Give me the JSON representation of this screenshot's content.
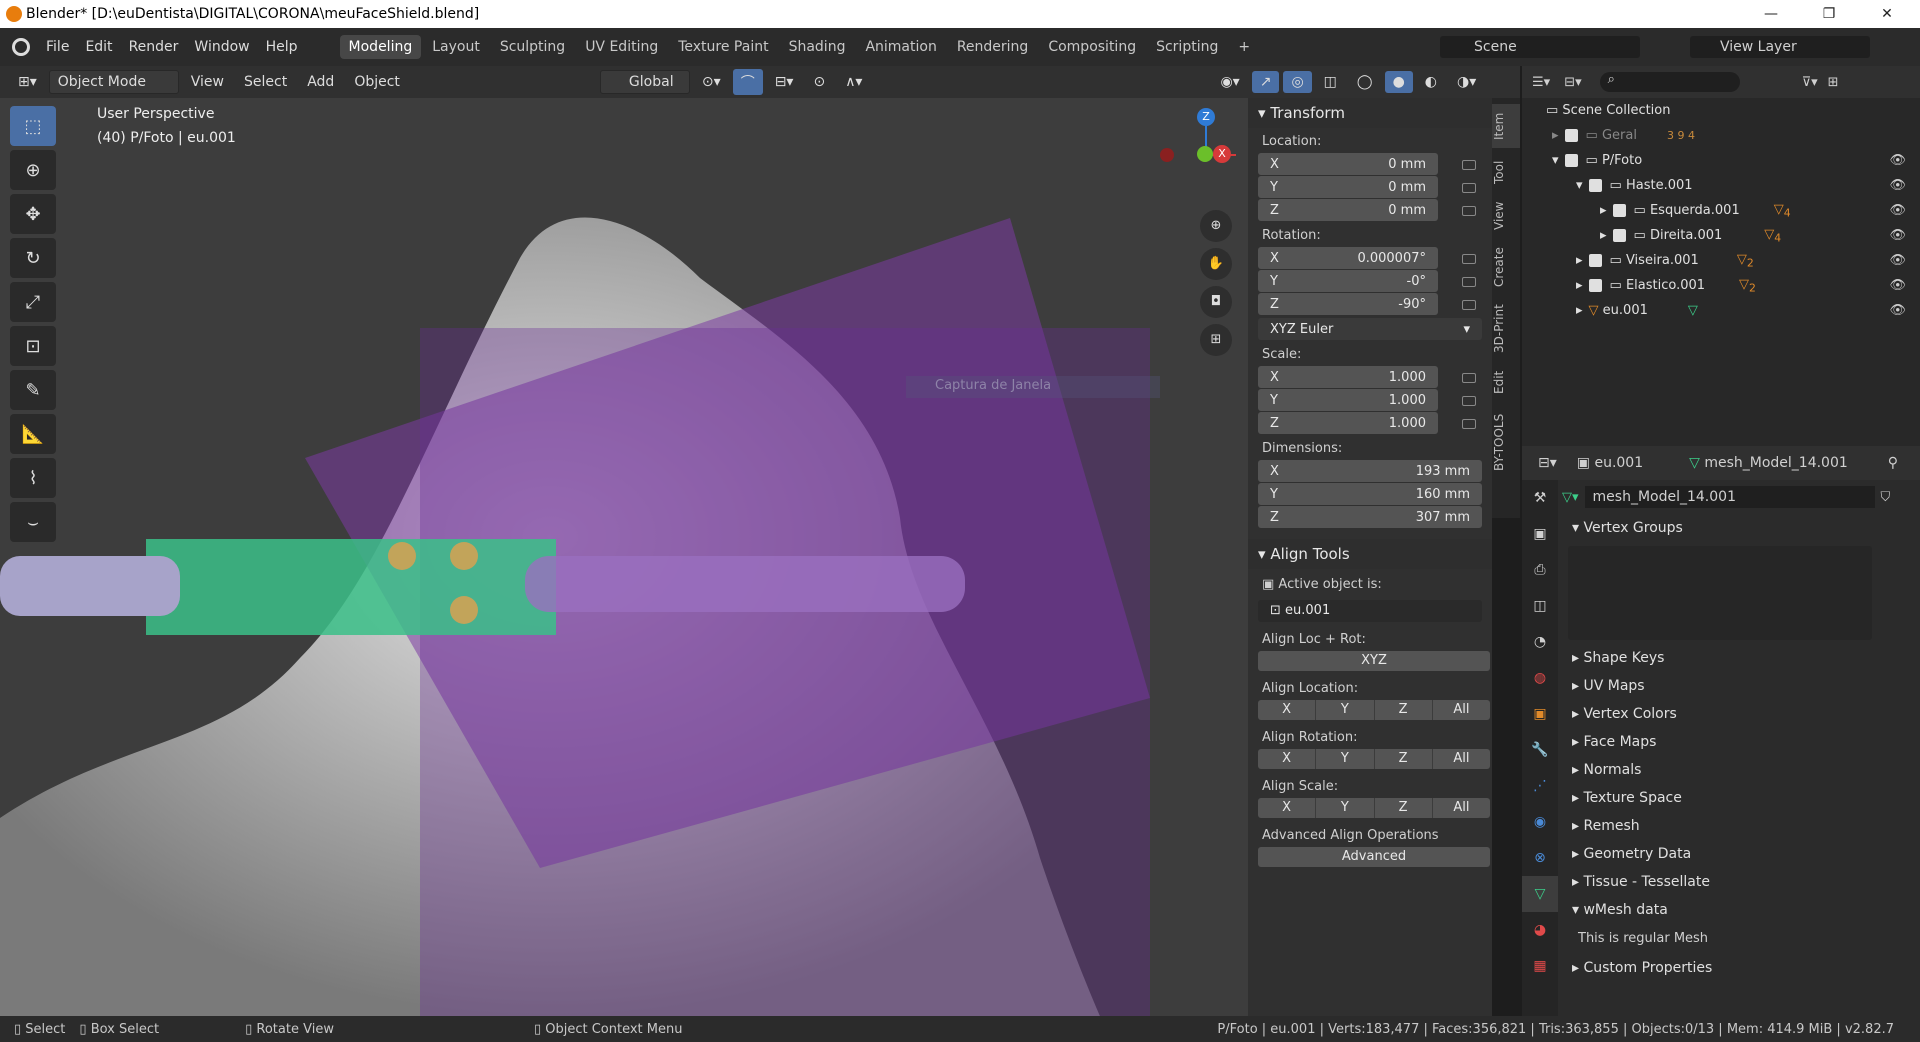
{
  "window": {
    "title": "Blender* [D:\\euDentista\\DIGITAL\\CORONA\\meuFaceShield.blend]",
    "minimize": "—",
    "maximize": "❐",
    "close": "✕"
  },
  "menu": {
    "file": "File",
    "edit": "Edit",
    "render": "Render",
    "window": "Window",
    "help": "Help"
  },
  "workspaces": [
    "Modeling",
    "Layout",
    "Sculpting",
    "UV Editing",
    "Texture Paint",
    "Shading",
    "Animation",
    "Rendering",
    "Compositing",
    "Scripting"
  ],
  "scene": {
    "label": "Scene",
    "view_layer": "View Layer"
  },
  "header": {
    "mode": "Object Mode",
    "view": "View",
    "select": "Select",
    "add": "Add",
    "object": "Object",
    "orientation": "Global"
  },
  "viewport": {
    "perspective": "User Perspective",
    "object_info": "(40) P/Foto | eu.001",
    "ghost_label": "Captura de Janela"
  },
  "gizmo": {
    "z": "Z",
    "x": "X"
  },
  "side_tabs": [
    "Item",
    "Tool",
    "View",
    "Create",
    "3D-Print",
    "Edit",
    "BY-TOOLS"
  ],
  "transform": {
    "title": "Transform",
    "location_label": "Location:",
    "rotation_label": "Rotation:",
    "scale_label": "Scale:",
    "dimensions_label": "Dimensions:",
    "rotation_mode": "XYZ Euler",
    "location": [
      {
        "axis": "X",
        "value": "0 mm"
      },
      {
        "axis": "Y",
        "value": "0 mm"
      },
      {
        "axis": "Z",
        "value": "0 mm"
      }
    ],
    "rotation": [
      {
        "axis": "X",
        "value": "0.000007°"
      },
      {
        "axis": "Y",
        "value": "-0°"
      },
      {
        "axis": "Z",
        "value": "-90°"
      }
    ],
    "scale": [
      {
        "axis": "X",
        "value": "1.000"
      },
      {
        "axis": "Y",
        "value": "1.000"
      },
      {
        "axis": "Z",
        "value": "1.000"
      }
    ],
    "dimensions": [
      {
        "axis": "X",
        "value": "193 mm"
      },
      {
        "axis": "Y",
        "value": "160 mm"
      },
      {
        "axis": "Z",
        "value": "307 mm"
      }
    ]
  },
  "align": {
    "title": "Align Tools",
    "active_label": "Active object is:",
    "active_obj": "eu.001",
    "loc_rot": "Align Loc + Rot:",
    "xyz": "XYZ",
    "location": "Align Location:",
    "rotation": "Align Rotation:",
    "scale": "Align Scale:",
    "x": "X",
    "y": "Y",
    "z": "Z",
    "all": "All",
    "advanced_ops": "Advanced Align Operations",
    "advanced": "Advanced"
  },
  "outliner": {
    "root": "Scene Collection",
    "items": [
      {
        "name": "Geral",
        "badges": "3 9 4"
      },
      {
        "name": "P/Foto"
      },
      {
        "name": "Haste.001"
      },
      {
        "name": "Esquerda.001",
        "badge": "4"
      },
      {
        "name": "Direita.001",
        "badge": "4"
      },
      {
        "name": "Viseira.001",
        "badge": "2"
      },
      {
        "name": "Elastico.001",
        "badge": "2"
      },
      {
        "name": "eu.001"
      }
    ]
  },
  "properties": {
    "object": "eu.001",
    "mesh": "mesh_Model_14.001",
    "mesh_field": "mesh_Model_14.001",
    "vertex_groups": "Vertex Groups",
    "sections": [
      "Shape Keys",
      "UV Maps",
      "Vertex Colors",
      "Face Maps",
      "Normals",
      "Texture Space",
      "Remesh",
      "Geometry Data",
      "Tissue - Tessellate"
    ],
    "wmesh": "wMesh data",
    "wmesh_text": "This is regular Mesh",
    "custom": "Custom Properties"
  },
  "status": {
    "select": "Select",
    "box_select": "Box Select",
    "rotate": "Rotate View",
    "context": "Object Context Menu",
    "info": "P/Foto | eu.001 | Verts:183,477 | Faces:356,821 | Tris:363,855 | Objects:0/13 | Mem: 414.9 MiB | v2.82.7"
  }
}
